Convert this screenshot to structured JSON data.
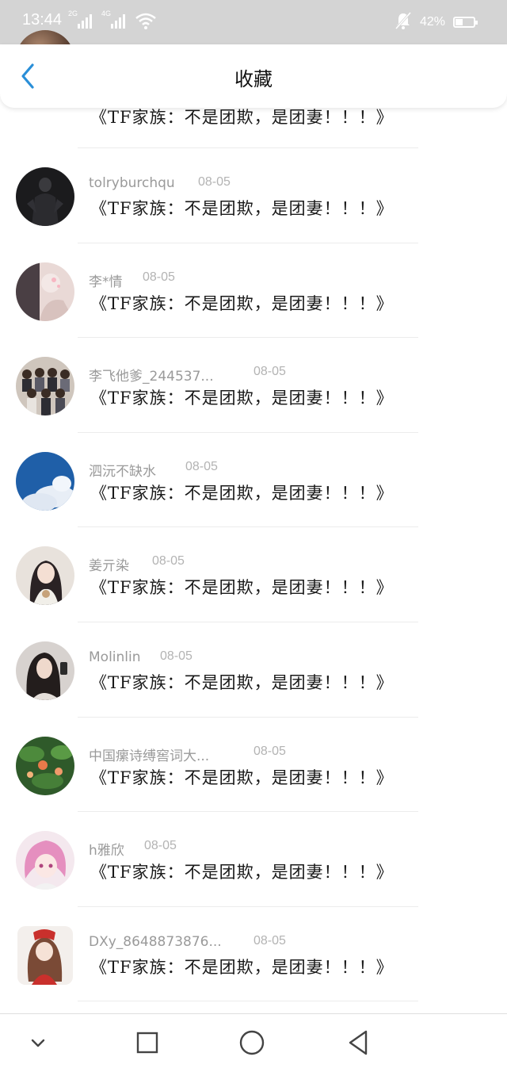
{
  "status_bar": {
    "time": "13:44",
    "sim1_label": "2G",
    "sim2_label": "4G",
    "battery_percent": "42%",
    "battery_level": 0.42,
    "icons": [
      "signal-icon",
      "signal-icon",
      "wifi-icon",
      "muted-bell-icon",
      "battery-icon"
    ]
  },
  "header": {
    "title": "收藏",
    "back_icon": "chevron-left-icon",
    "accent_color": "#2a8fd8"
  },
  "items": [
    {
      "user": "",
      "date": "",
      "title": "《TF家族：不是团欺，是团妻！！！》"
    },
    {
      "user": "tolryburchqu",
      "date": "08-05",
      "title": "《TF家族：不是团欺，是团妻！！！》"
    },
    {
      "user": "李*情",
      "date": "08-05",
      "title": "《TF家族：不是团欺，是团妻！！！》"
    },
    {
      "user": "李飞他爹_244537...",
      "date": "08-05",
      "title": "《TF家族：不是团欺，是团妻！！！》"
    },
    {
      "user": "泗沅不缺水",
      "date": "08-05",
      "title": "《TF家族：不是团欺，是团妻！！！》"
    },
    {
      "user": "姜亓染",
      "date": "08-05",
      "title": "《TF家族：不是团欺，是团妻！！！》"
    },
    {
      "user": "Molinlin",
      "date": "08-05",
      "title": "《TF家族：不是团欺，是团妻！！！》"
    },
    {
      "user": "中国瘰诗缚窖词大...",
      "date": "08-05",
      "title": "《TF家族：不是团欺，是团妻！！！》"
    },
    {
      "user": "h雅欣",
      "date": "08-05",
      "title": "《TF家族：不是团欺，是团妻！！！》"
    },
    {
      "user": "DXy_8648873876...",
      "date": "08-05",
      "title": "《TF家族：不是团欺，是团妻！！！》"
    }
  ],
  "nav_bar": {
    "icons": [
      "chevron-down-icon",
      "square-icon",
      "circle-icon",
      "triangle-back-icon"
    ]
  }
}
